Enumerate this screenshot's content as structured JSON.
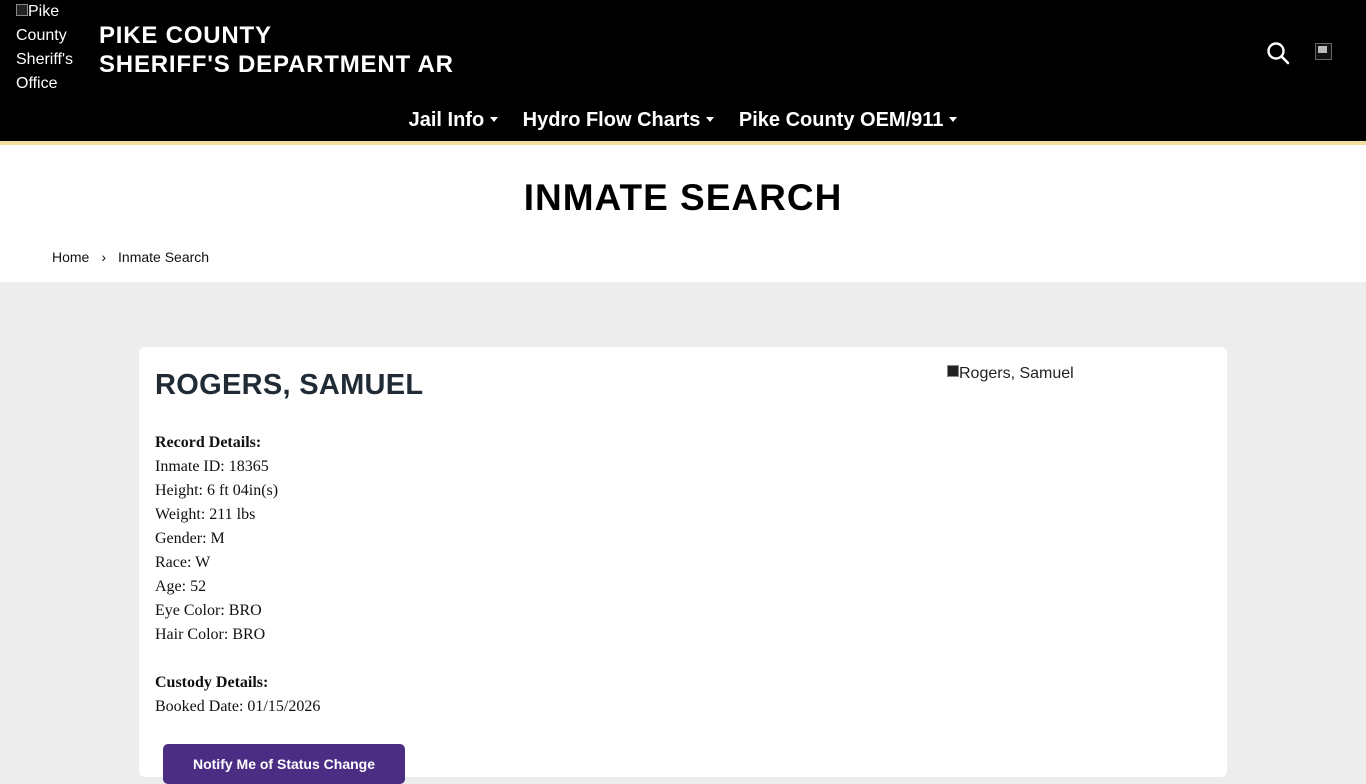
{
  "header": {
    "logo_alt": "Pike County Sheriff's Office",
    "title_line1": "PIKE COUNTY",
    "title_line2": "SHERIFF'S DEPARTMENT AR",
    "nav": [
      {
        "label": "Jail Info"
      },
      {
        "label": "Hydro Flow Charts"
      },
      {
        "label": "Pike County OEM/911"
      }
    ],
    "search_icon": "search-icon",
    "accent_color": "#f2dfa0"
  },
  "page": {
    "title": "INMATE SEARCH",
    "breadcrumb": {
      "home": "Home",
      "separator": "›",
      "current": "Inmate Search"
    }
  },
  "inmate": {
    "name": "ROGERS, SAMUEL",
    "photo_alt": "Rogers, Samuel",
    "record_heading": "Record Details:",
    "inmate_id": "Inmate ID: 18365",
    "height": "Height: 6 ft 04in(s)",
    "weight": "Weight: 211 lbs",
    "gender": "Gender: M",
    "race": "Race: W",
    "age": "Age: 52",
    "eye_color": "Eye Color: BRO",
    "hair_color": "Hair Color: BRO",
    "custody_heading": "Custody Details:",
    "booked_date": "Booked Date: 01/15/2026",
    "notify_button": "Notify Me of Status Change"
  },
  "colors": {
    "header_bg": "#000000",
    "button_bg": "#4b2d83",
    "page_bg": "#ededed"
  }
}
